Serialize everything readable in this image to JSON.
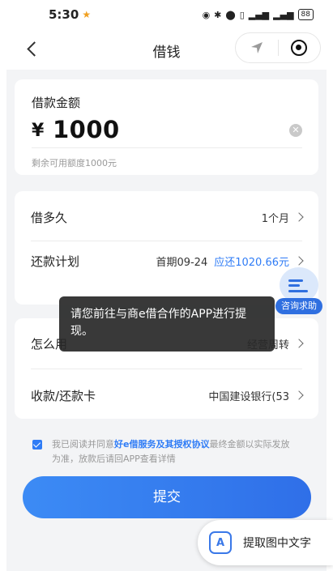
{
  "status_bar": {
    "time": "5:30",
    "battery": "88"
  },
  "nav": {
    "title": "借钱"
  },
  "amount": {
    "label": "借款金额",
    "currency": "¥",
    "value": "1000",
    "hint": "剩余可用额度1000元"
  },
  "plan": {
    "duration_label": "借多久",
    "duration_value": "1个月",
    "repay_label": "还款计划",
    "repay_first": "首期09-24",
    "repay_amount": "应还1020.66元"
  },
  "usage": {
    "use_label": "怎么用",
    "use_value": "经营周转",
    "card_label": "收款/还款卡",
    "card_value": "中国建设银行(53"
  },
  "consult": {
    "label": "咨询求助"
  },
  "toast": {
    "text": "请您前往与商e借合作的APP进行提现。"
  },
  "agreement": {
    "prefix": "我已阅读并同意",
    "link": "好e借服务及其授权协议",
    "suffix": "最终金额以实际发放为准，放款后请回APP查看详情"
  },
  "submit_label": "提交",
  "extract": {
    "icon_letter": "A",
    "label": "提取图中文字"
  },
  "colors": {
    "accent": "#2f7cf6",
    "toast_bg": "#282828"
  }
}
